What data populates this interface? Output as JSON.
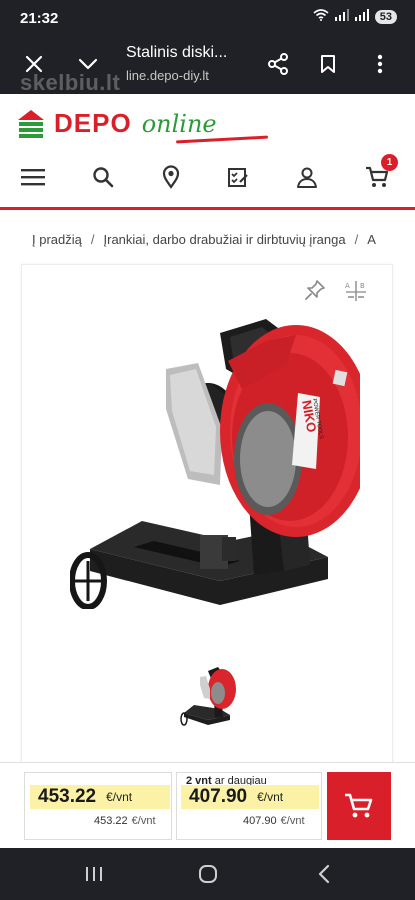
{
  "status_bar": {
    "time": "21:32",
    "battery": "53",
    "colors": {
      "bg": "#1f2126"
    }
  },
  "browser": {
    "title": "Stalinis diski...",
    "url": "line.depo-diy.lt",
    "watermark": "skelbiu.lt",
    "icons": [
      "close-icon",
      "chevron-down-icon",
      "share-icon",
      "bookmark-icon",
      "more-vertical-icon"
    ]
  },
  "site": {
    "logo_text": "DEPO",
    "logo_online": "online",
    "cart_count": "1",
    "nav_icons": [
      "menu-icon",
      "search-icon",
      "location-pin-icon",
      "checklist-icon",
      "user-icon",
      "cart-icon"
    ],
    "colors": {
      "brand_red": "#d9202a",
      "brand_green": "#2d9a3a"
    }
  },
  "breadcrumb": {
    "items": [
      "Į pradžią",
      "Įrankiai, darbo drabužiai ir dirbtuvių įranga",
      "A"
    ],
    "separator": "/"
  },
  "gallery": {
    "icons": [
      "pin-icon",
      "compare-icon"
    ],
    "product_brand": "NIKO",
    "product_brand_sub": "POWER TOOLS"
  },
  "pricing": {
    "unit_price": "453.22",
    "unit_price_unit": "€/vnt",
    "unit_price_small": "453.22",
    "unit_price_small_unit": "€/vnt",
    "tier_qty": "2 vnt",
    "tier_label": "ar daugiau",
    "tier_price": "407.90",
    "tier_price_unit": "€/vnt",
    "tier_price_small": "407.90",
    "tier_price_small_unit": "€/vnt",
    "colors": {
      "highlight": "#fbf2a8",
      "button": "#d9202a"
    }
  },
  "android_nav": {
    "icons": [
      "recent-apps-icon",
      "home-icon",
      "back-icon"
    ]
  }
}
